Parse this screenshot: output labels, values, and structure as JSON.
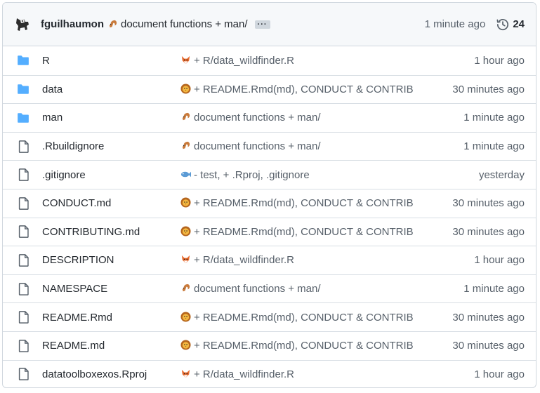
{
  "latest_commit": {
    "author": "fguilhaumon",
    "emoji": "squirrel-emoji",
    "message": "document functions + man/",
    "more_label": "···",
    "time": "1 minute ago",
    "commit_count": "24"
  },
  "files": [
    {
      "type": "folder",
      "name": "R",
      "emoji": "fox-emoji",
      "commit": "+ R/data_wildfinder.R",
      "age": "1 hour ago"
    },
    {
      "type": "folder",
      "name": "data",
      "emoji": "lion-emoji",
      "commit": "+ README.Rmd(md), CONDUCT & CONTRIB",
      "age": "30 minutes ago"
    },
    {
      "type": "folder",
      "name": "man",
      "emoji": "squirrel-emoji",
      "commit": "document functions + man/",
      "age": "1 minute ago"
    },
    {
      "type": "file",
      "name": ".Rbuildignore",
      "emoji": "squirrel-emoji",
      "commit": "document functions + man/",
      "age": "1 minute ago"
    },
    {
      "type": "file",
      "name": ".gitignore",
      "emoji": "fish-emoji",
      "commit": "- test, + .Rproj, .gitignore",
      "age": "yesterday"
    },
    {
      "type": "file",
      "name": "CONDUCT.md",
      "emoji": "lion-emoji",
      "commit": "+ README.Rmd(md), CONDUCT & CONTRIB",
      "age": "30 minutes ago"
    },
    {
      "type": "file",
      "name": "CONTRIBUTING.md",
      "emoji": "lion-emoji",
      "commit": "+ README.Rmd(md), CONDUCT & CONTRIB",
      "age": "30 minutes ago"
    },
    {
      "type": "file",
      "name": "DESCRIPTION",
      "emoji": "fox-emoji",
      "commit": "+ R/data_wildfinder.R",
      "age": "1 hour ago"
    },
    {
      "type": "file",
      "name": "NAMESPACE",
      "emoji": "squirrel-emoji",
      "commit": "document functions + man/",
      "age": "1 minute ago"
    },
    {
      "type": "file",
      "name": "README.Rmd",
      "emoji": "lion-emoji",
      "commit": "+ README.Rmd(md), CONDUCT & CONTRIB",
      "age": "30 minutes ago"
    },
    {
      "type": "file",
      "name": "README.md",
      "emoji": "lion-emoji",
      "commit": "+ README.Rmd(md), CONDUCT & CONTRIB",
      "age": "30 minutes ago"
    },
    {
      "type": "file",
      "name": "datatoolboxexos.Rproj",
      "emoji": "fox-emoji",
      "commit": "+ R/data_wildfinder.R",
      "age": "1 hour ago"
    }
  ],
  "colors": {
    "folder": "#54aeff",
    "file_icon": "#57606a",
    "muted": "#57606a",
    "border": "#d0d7de"
  }
}
